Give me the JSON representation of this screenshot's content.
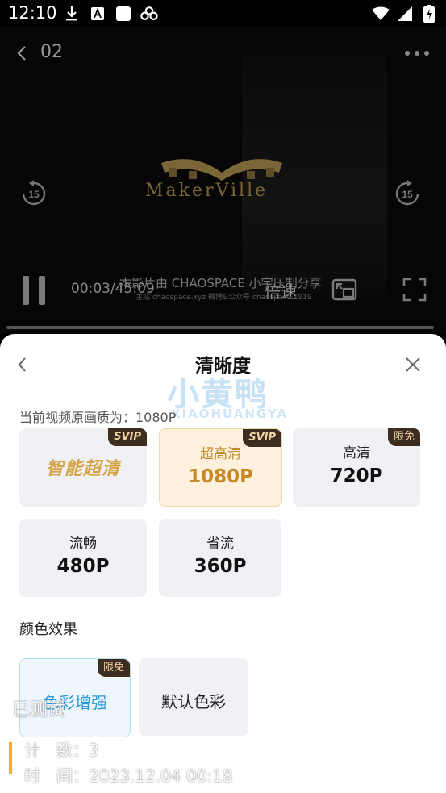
{
  "status_bar": {
    "time": "12:10",
    "left_icons": [
      "download-icon",
      "font-a-icon",
      "square-app-icon",
      "link-icon"
    ],
    "right_icons": [
      "wifi-icon",
      "cellular-signal-icon",
      "battery-icon"
    ]
  },
  "player": {
    "episode": "02",
    "logo_text": "MakerVille",
    "time_readout": "00:03/45:09",
    "subtitle": "本影片由 CHAOSPACE 小宇压制分享",
    "subtitle_small": "主站 chaospace.xyz 微博&公众号 chaospace.1919",
    "speed_label": "倍速",
    "rewind_seconds": "15",
    "forward_seconds": "15"
  },
  "sheet": {
    "title": "清晰度",
    "watermark_cn": "小黄鸭",
    "watermark_en": "XIAOHUANGYA",
    "current_quality": "当前视频原画质为：1080P",
    "qualities": [
      {
        "label": "",
        "value": "",
        "special": "智能超清",
        "badge": "SVIP",
        "active": false
      },
      {
        "label": "超高清",
        "value": "1080P",
        "badge": "SVIP",
        "active": true
      },
      {
        "label": "高清",
        "value": "720P",
        "badge": "限免",
        "active": false
      },
      {
        "label": "流畅",
        "value": "480P",
        "badge": "",
        "active": false
      },
      {
        "label": "省流",
        "value": "360P",
        "badge": "",
        "active": false
      }
    ],
    "color_effect_title": "颜色效果",
    "color_options": [
      {
        "label": "色彩增强",
        "badge": "限免",
        "selected": true
      },
      {
        "label": "默认色彩",
        "badge": "",
        "selected": false
      }
    ]
  },
  "overlay": {
    "label": "已测试",
    "count": "计　数：3",
    "time": "时　间：2023.12.04 00:18"
  },
  "colors": {
    "accent_gold": "#c88726",
    "badge_bg": "#3d2c20",
    "enhance_blue": "#2a9ad6"
  }
}
